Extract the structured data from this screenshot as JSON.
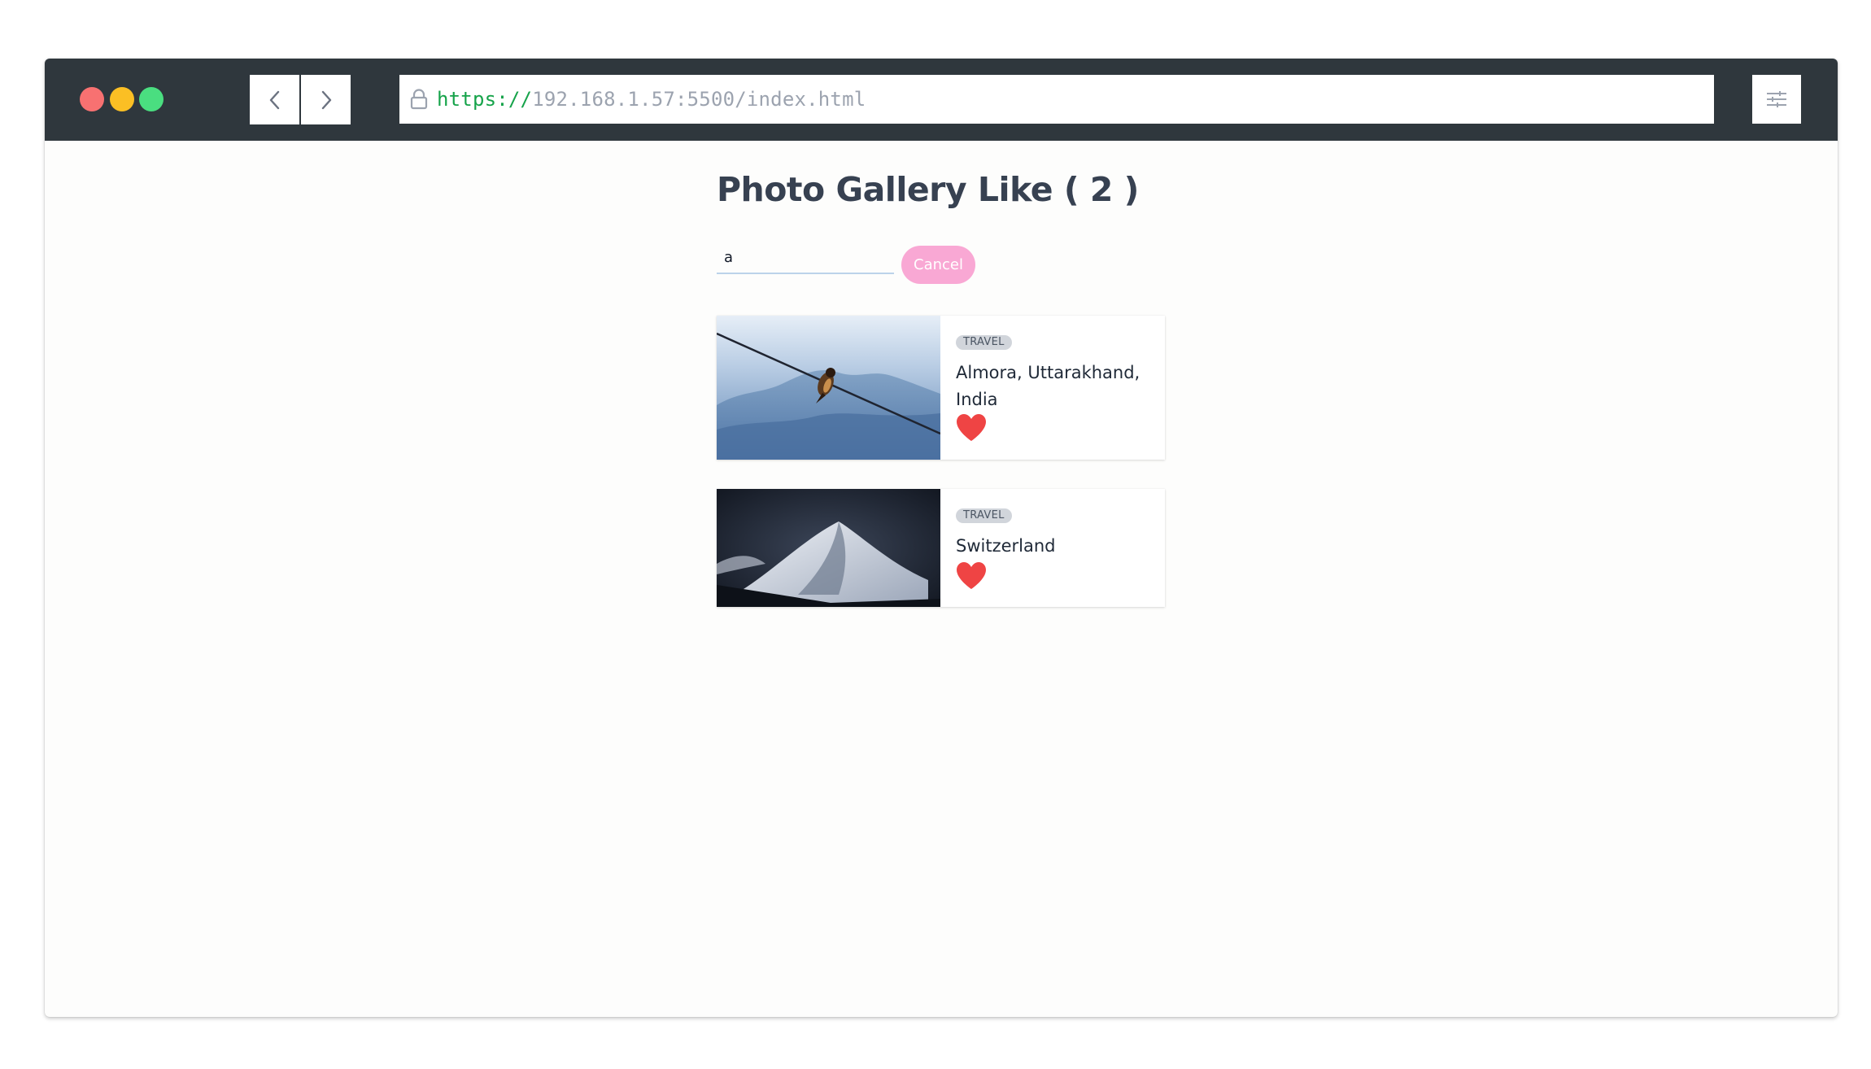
{
  "browser": {
    "url_protocol": "https://",
    "url_rest": "192.168.1.57:5500/index.html",
    "icons": [
      "back-icon",
      "forward-icon",
      "lock-icon",
      "sliders-icon"
    ]
  },
  "page": {
    "title": "Photo Gallery Like ( 2 )",
    "search": {
      "value": "a",
      "placeholder": ""
    },
    "cancel_label": "Cancel"
  },
  "cards": [
    {
      "tag": "TRAVEL",
      "place": "Almora, Uttarakhand, India",
      "liked": true,
      "image": "bird on wire against mountains"
    },
    {
      "tag": "TRAVEL",
      "place": "Switzerland",
      "liked": true,
      "image": "snowy mountain peak at night"
    }
  ],
  "colors": {
    "titlebar": "#2f373d",
    "heart": "#ef4444",
    "cancel_button": "#f9a8d4",
    "url_protocol": "#16a34a"
  }
}
